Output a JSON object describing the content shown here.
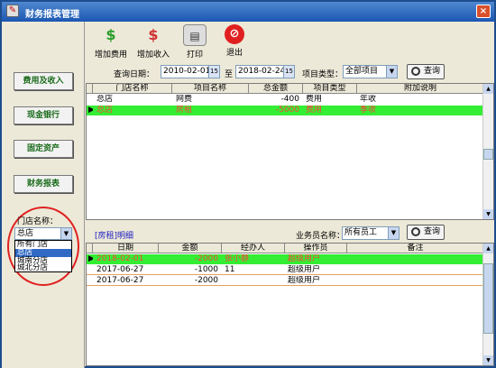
{
  "window": {
    "title": "财务报表管理",
    "close_label": "×"
  },
  "nav": {
    "items": [
      {
        "label": "费用及收入"
      },
      {
        "label": "现金银行"
      },
      {
        "label": "固定资产"
      },
      {
        "label": "财务报表"
      }
    ],
    "store_label": "门店名称：",
    "store_selected": "总店",
    "store_options": [
      "所有门店",
      "总店",
      "城南分店",
      "城北分店"
    ]
  },
  "toolbar": {
    "add_expense": "增加费用",
    "add_income": "增加收入",
    "print": "打印",
    "exit": "退出"
  },
  "query": {
    "date_label": "查询日期：",
    "date_from": "2010-02-01",
    "to_label": "至",
    "date_to": "2018-02-24",
    "type_label": "项目类型：",
    "type_value": "全部项目",
    "query_button": "查询"
  },
  "main_table": {
    "headers": [
      "门店名称",
      "项目名称",
      "总金额",
      "项目类型",
      "附加说明"
    ],
    "rows": [
      [
        "总店",
        "网费",
        "-400",
        "费用",
        "年收"
      ],
      [
        "总店",
        "房租",
        "-5000",
        "费用",
        "季收"
      ]
    ]
  },
  "detail": {
    "title": "[房租]明细",
    "staff_label": "业务员名称：",
    "staff_value": "所有员工",
    "query_button": "查询",
    "headers": [
      "日期",
      "金额",
      "经办人",
      "操作员",
      "备注"
    ],
    "rows": [
      [
        "2018-02-01",
        "-2000",
        "张小静",
        "超级用户",
        ""
      ],
      [
        "2017-06-27",
        "-1000",
        "11",
        "超级用户",
        ""
      ],
      [
        "2017-06-27",
        "-2000",
        "",
        "超级用户",
        ""
      ]
    ]
  },
  "colors": {
    "titlebar": "#1b56b3",
    "selected_row": "#33ee33",
    "selected_text": "#ff4040",
    "nav_text": "#1a6b1a",
    "highlight_circle": "#e02020"
  }
}
